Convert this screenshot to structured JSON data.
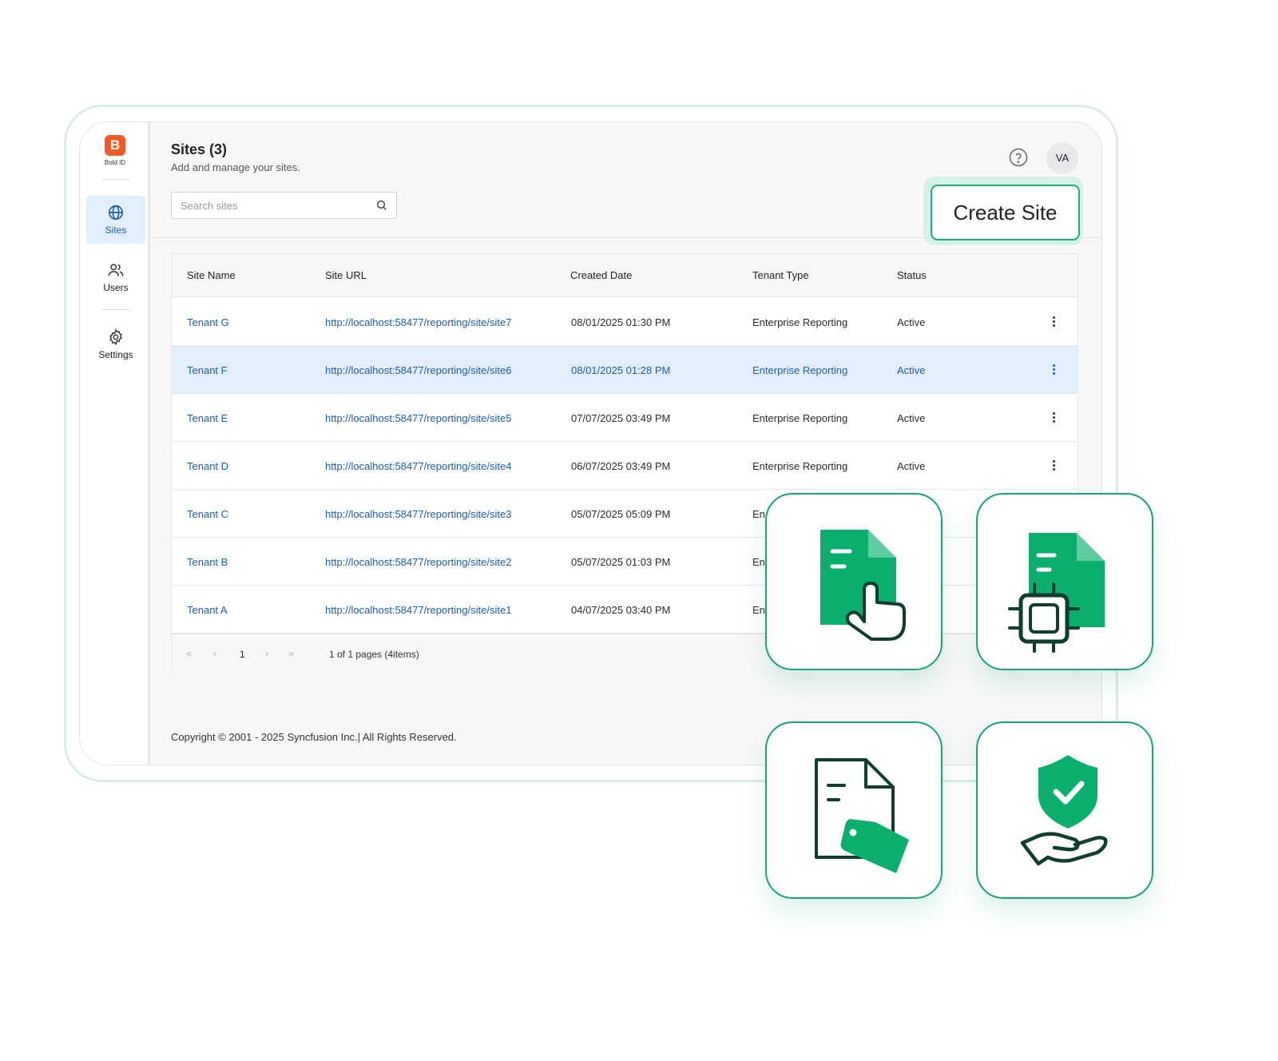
{
  "brand": {
    "name": "Bold ID",
    "mark": "B"
  },
  "sidebar": {
    "items": [
      {
        "label": "Sites",
        "icon": "globe-icon",
        "active": true
      },
      {
        "label": "Users",
        "icon": "users-icon",
        "active": false
      },
      {
        "label": "Settings",
        "icon": "gear-icon",
        "active": false
      }
    ]
  },
  "header": {
    "title": "Sites (3)",
    "subtitle": "Add and manage your sites.",
    "avatar": "VA",
    "search_placeholder": "Search sites",
    "create_label": "Create Site"
  },
  "table": {
    "columns": [
      "Site Name",
      "Site URL",
      "Created Date",
      "Tenant Type",
      "Status"
    ],
    "rows": [
      {
        "name": "Tenant G",
        "url": "http://localhost:58477/reporting/site/site7",
        "date": "08/01/2025 01:30 PM",
        "type": "Enterprise Reporting",
        "status": "Active",
        "selected": false
      },
      {
        "name": "Tenant F",
        "url": "http://localhost:58477/reporting/site/site6",
        "date": "08/01/2025 01:28 PM",
        "type": "Enterprise Reporting",
        "status": "Active",
        "selected": true
      },
      {
        "name": "Tenant E",
        "url": "http://localhost:58477/reporting/site/site5",
        "date": "07/07/2025 03:49 PM",
        "type": "Enterprise Reporting",
        "status": "Active",
        "selected": false
      },
      {
        "name": "Tenant D",
        "url": "http://localhost:58477/reporting/site/site4",
        "date": "06/07/2025 03:49 PM",
        "type": "Enterprise Reporting",
        "status": "Active",
        "selected": false
      },
      {
        "name": "Tenant C",
        "url": "http://localhost:58477/reporting/site/site3",
        "date": "05/07/2025 05:09 PM",
        "type": "En",
        "status": "",
        "selected": false
      },
      {
        "name": "Tenant B",
        "url": "http://localhost:58477/reporting/site/site2",
        "date": "05/07/2025 01:03 PM",
        "type": "En",
        "status": "",
        "selected": false
      },
      {
        "name": "Tenant A",
        "url": "http://localhost:58477/reporting/site/site1",
        "date": "04/07/2025 03:40 PM",
        "type": "En",
        "status": "",
        "selected": false
      }
    ]
  },
  "pager": {
    "first": "«",
    "prev": "‹",
    "page": "1",
    "next": "›",
    "last": "»",
    "info": "1 of 1 pages (4items)"
  },
  "footer": {
    "copyright": "Copyright © 2001 - 2025 Syncfusion Inc.| All Rights Reserved."
  },
  "feature_cards": [
    {
      "icon": "document-tap-icon"
    },
    {
      "icon": "document-chip-icon"
    },
    {
      "icon": "document-tag-icon"
    },
    {
      "icon": "shield-hand-icon"
    }
  ],
  "colors": {
    "accent_green": "#0aaf6e",
    "icon_dark": "#0f3d2e",
    "link_blue": "#1a5fb4",
    "selected_row": "#e3eefc",
    "brand_orange": "#f15a24"
  }
}
